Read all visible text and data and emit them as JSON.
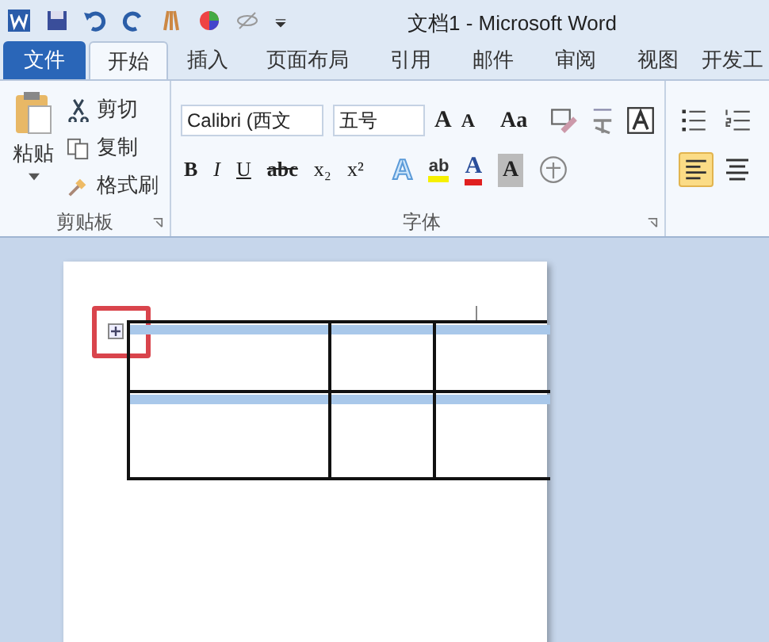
{
  "window": {
    "title": "文档1 - Microsoft Word"
  },
  "tabs": [
    {
      "label": "文件",
      "kind": "file",
      "selected": false
    },
    {
      "label": "开始",
      "kind": "tab",
      "selected": true
    },
    {
      "label": "插入",
      "kind": "tab",
      "selected": false
    },
    {
      "label": "页面布局",
      "kind": "tab",
      "selected": false
    },
    {
      "label": "引用",
      "kind": "tab",
      "selected": false
    },
    {
      "label": "邮件",
      "kind": "tab",
      "selected": false
    },
    {
      "label": "审阅",
      "kind": "tab",
      "selected": false
    },
    {
      "label": "视图",
      "kind": "tab",
      "selected": false
    },
    {
      "label": "开发工",
      "kind": "tab",
      "selected": false
    }
  ],
  "clipboard": {
    "paste": "粘贴",
    "actions": [
      "剪切",
      "复制",
      "格式刷"
    ],
    "label": "剪贴板"
  },
  "font": {
    "name": "Calibri (西文",
    "size": "五号",
    "grow": "A",
    "shrink": "A",
    "case": "Aa",
    "format_buttons": [
      "B",
      "I",
      "U",
      "abc",
      "x₂",
      "x²"
    ],
    "text_effect": "A",
    "highlight": "ab",
    "font_color": "A",
    "shading": "A",
    "label": "字体"
  },
  "paragraph": {
    "align_buttons": [
      {
        "selected": true
      },
      {
        "selected": false
      }
    ]
  },
  "document": {
    "move_handle_highlighted": true
  }
}
